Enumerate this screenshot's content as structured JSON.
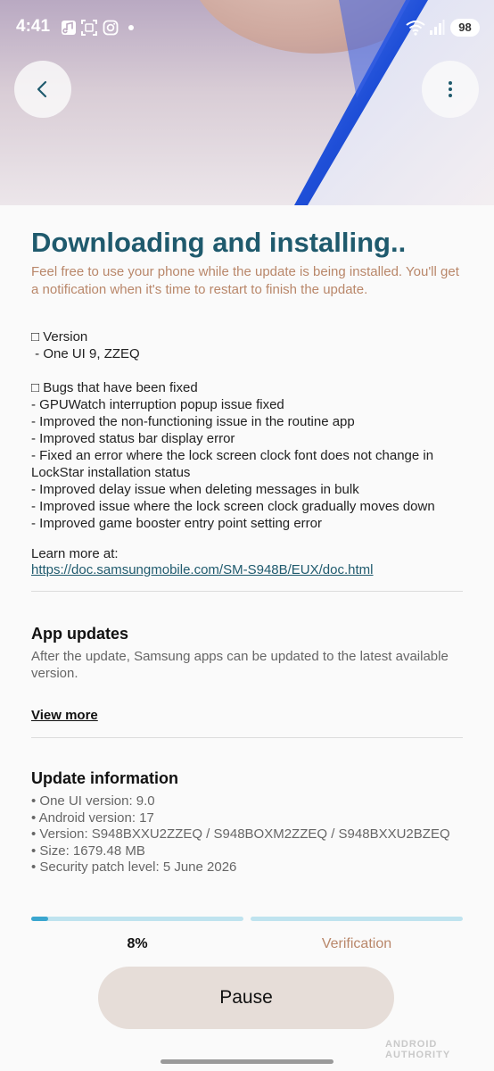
{
  "status_bar": {
    "time": "4:41",
    "battery": "98",
    "icons": [
      "music-note-icon",
      "screen-capture-icon",
      "instagram-icon",
      "wifi-icon",
      "signal-icon"
    ]
  },
  "header": {
    "back_icon": "chevron-left-icon",
    "menu_icon": "more-vertical-icon"
  },
  "main": {
    "title": "Downloading and installing..",
    "subtitle": "Feel free to use your phone while the update is being installed. You'll get a notification when it's time to restart to finish the update.",
    "notes": {
      "version_heading": "□ Version",
      "version_value": " - One UI 9, ZZEQ",
      "bugs_heading": "□ Bugs that have been fixed",
      "bugs": [
        "- GPUWatch interruption popup issue fixed",
        "- Improved the non-functioning issue in the routine app",
        "- Improved status bar display error",
        "- Fixed an error where the lock screen clock font does not change in LockStar installation status",
        "- Improved delay issue when deleting messages in bulk",
        "- Improved issue where the lock screen clock gradually moves down",
        "- Improved game booster entry point setting error"
      ],
      "learn_more": "Learn more at:",
      "link": "https://doc.samsungmobile.com/SM-S948B/EUX/doc.html"
    }
  },
  "app_updates": {
    "title": "App updates",
    "description": "After the update, Samsung apps can be updated to the latest available version.",
    "view_more": "View more"
  },
  "update_info": {
    "title": "Update information",
    "items": [
      "• One UI version: 9.0",
      "• Android version: 17",
      "• Version: S948BXXU2ZZEQ / S948BOXM2ZZEQ / S948BXXU2BZEQ",
      "• Size: 1679.48 MB",
      "• Security patch level: 5 June 2026"
    ]
  },
  "progress": {
    "download_fraction": 0.08,
    "verification_fraction": 0,
    "percent_label": "8%",
    "verification_label": "Verification"
  },
  "actions": {
    "pause_label": "Pause"
  },
  "watermark": "ANDROID AUTHORITY",
  "colors": {
    "title": "#1f5a6d",
    "accent_text": "#b9876a",
    "progress_fill": "#3aa6cf",
    "progress_track": "#bfe3ef",
    "button_bg": "#e6ddd8"
  }
}
